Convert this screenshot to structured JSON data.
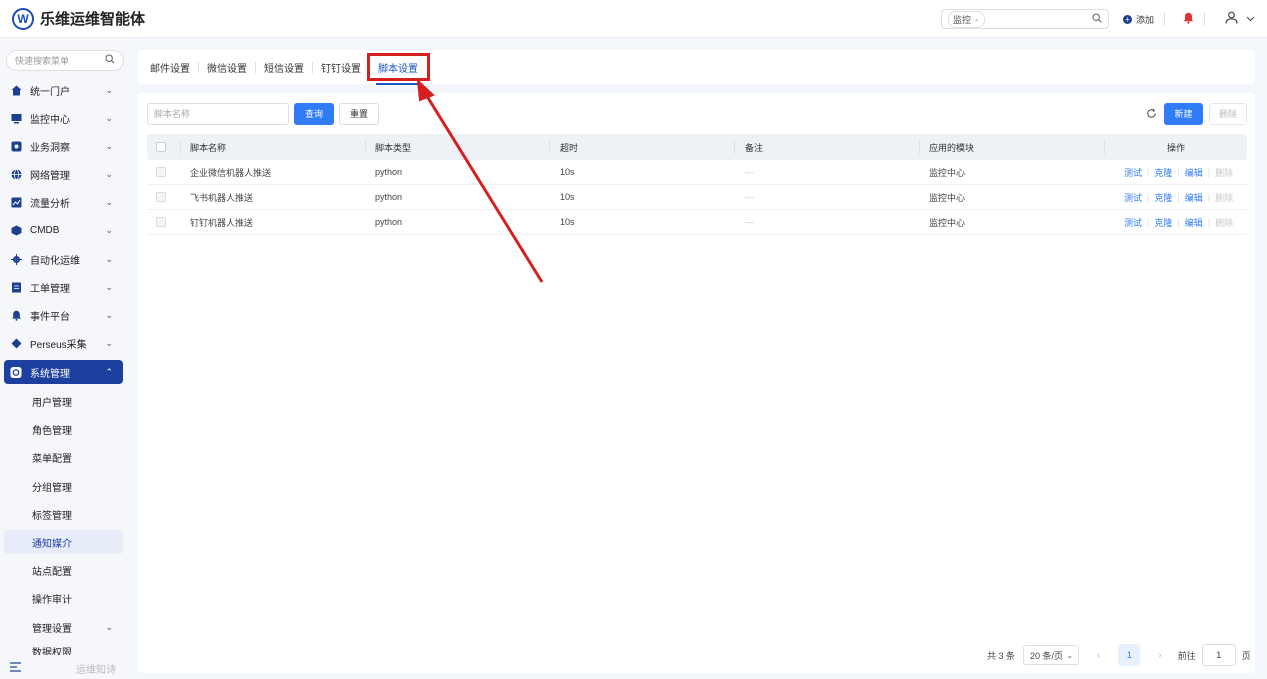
{
  "app": {
    "logo_letter": "W",
    "title": "乐维运维智能体"
  },
  "topbar": {
    "search_scope": "监控",
    "add_label": "添加"
  },
  "sidebar": {
    "search_placeholder": "快速搜索菜单",
    "menu": [
      {
        "label": "统一门户",
        "icon": "home-icon"
      },
      {
        "label": "监控中心",
        "icon": "monitor-icon"
      },
      {
        "label": "业务洞察",
        "icon": "insight-icon"
      },
      {
        "label": "网络管理",
        "icon": "globe-icon"
      },
      {
        "label": "流量分析",
        "icon": "traffic-icon"
      },
      {
        "label": "CMDB",
        "icon": "cube-icon"
      },
      {
        "label": "自动化运维",
        "icon": "gear-icon"
      },
      {
        "label": "工单管理",
        "icon": "ticket-icon"
      },
      {
        "label": "事件平台",
        "icon": "bell-icon"
      },
      {
        "label": "Perseus采集",
        "icon": "diamond-icon"
      },
      {
        "label": "系统管理",
        "icon": "settings-icon"
      }
    ],
    "submenu": [
      {
        "label": "用户管理"
      },
      {
        "label": "角色管理"
      },
      {
        "label": "菜单配置"
      },
      {
        "label": "分组管理"
      },
      {
        "label": "标签管理"
      },
      {
        "label": "通知媒介"
      },
      {
        "label": "站点配置"
      },
      {
        "label": "操作审计"
      },
      {
        "label": "管理设置"
      },
      {
        "label": "数据权限"
      }
    ],
    "bottom_text": "运维知诗"
  },
  "tabs": [
    {
      "label": "邮件设置"
    },
    {
      "label": "微信设置"
    },
    {
      "label": "短信设置"
    },
    {
      "label": "钉钉设置"
    },
    {
      "label": "脚本设置"
    }
  ],
  "filter": {
    "name_placeholder": "脚本名称",
    "query_label": "查询",
    "reset_label": "重置",
    "new_label": "新建",
    "delete_label": "删除"
  },
  "table": {
    "columns": [
      "脚本名称",
      "脚本类型",
      "超时",
      "备注",
      "应用的模块",
      "操作"
    ],
    "rows": [
      {
        "name": "企业微信机器人推送",
        "type": "python",
        "timeout": "10s",
        "note": "—",
        "module": "监控中心"
      },
      {
        "name": "飞书机器人推送",
        "type": "python",
        "timeout": "10s",
        "note": "—",
        "module": "监控中心"
      },
      {
        "name": "钉钉机器人推送",
        "type": "python",
        "timeout": "10s",
        "note": "—",
        "module": "监控中心"
      }
    ],
    "actions": {
      "test": "测试",
      "clone": "克隆",
      "edit": "编辑",
      "delete": "删除"
    }
  },
  "pagination": {
    "total": "共 3 条",
    "page_size": "20 条/页",
    "current_page": "1",
    "goto_label": "前往",
    "goto_value": "1",
    "page_unit": "页"
  },
  "colors": {
    "primary": "#2f7cf6",
    "sidebar_active": "#1c3fa0",
    "annotation_red": "#d42020"
  }
}
